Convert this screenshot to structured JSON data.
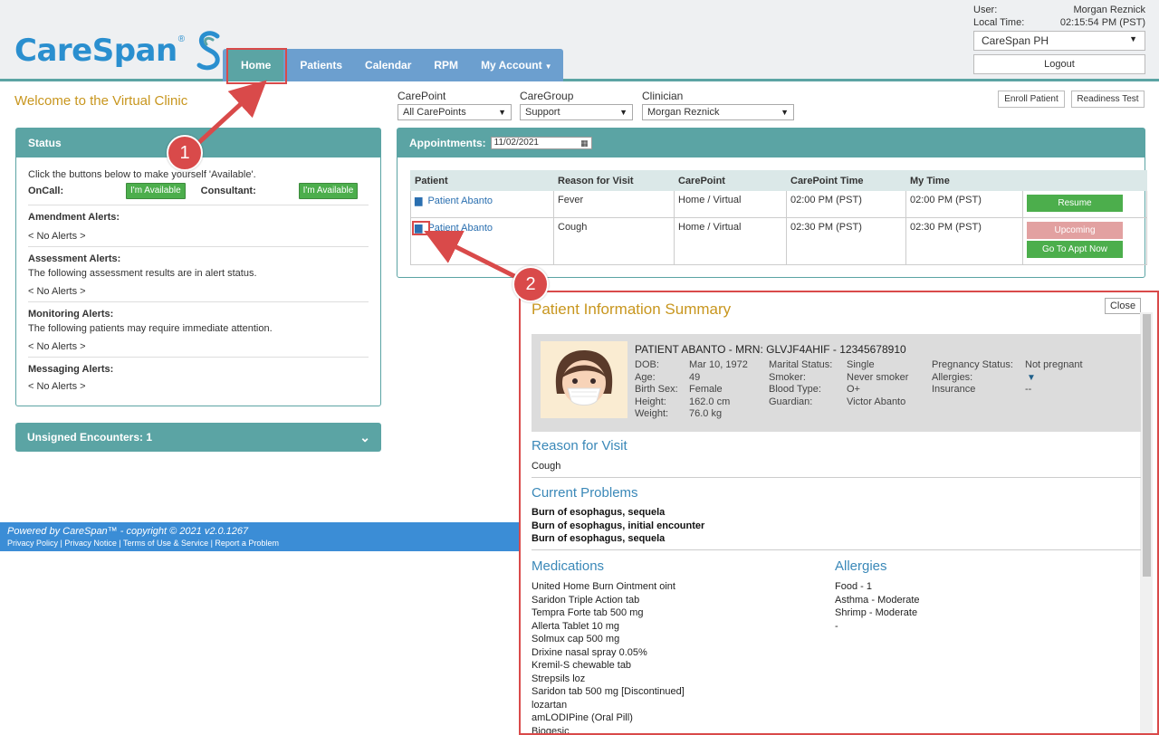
{
  "app": {
    "brand": "CareSpan",
    "brand_mark": "®"
  },
  "nav": {
    "home": "Home",
    "patients": "Patients",
    "calendar": "Calendar",
    "rpm": "RPM",
    "account": "My Account"
  },
  "user": {
    "user_label": "User:",
    "user_name": "Morgan Reznick",
    "time_label": "Local Time:",
    "time_value": "02:15:54 PM (PST)",
    "org": "CareSpan PH",
    "logout": "Logout"
  },
  "welcome": "Welcome to the Virtual Clinic",
  "filters": {
    "carepoint": {
      "label": "CarePoint",
      "value": "All CarePoints"
    },
    "caregroup": {
      "label": "CareGroup",
      "value": "Support"
    },
    "clinician": {
      "label": "Clinician",
      "value": "Morgan Reznick"
    }
  },
  "buttons": {
    "enroll": "Enroll Patient",
    "readiness": "Readiness Test"
  },
  "status": {
    "title": "Status",
    "intro": "Click the buttons below to make yourself 'Available'.",
    "oncall": "OnCall:",
    "consultant": "Consultant:",
    "available": "I'm Available",
    "amendment": "Amendment Alerts:",
    "no_alerts": "< No Alerts >",
    "assessment": "Assessment Alerts:",
    "assessment_desc": "The following assessment results are in alert status.",
    "monitoring": "Monitoring Alerts:",
    "monitoring_desc": "The following patients may require immediate attention.",
    "messaging": "Messaging Alerts:"
  },
  "unsigned": "Unsigned Encounters: 1",
  "footer": {
    "powered": "Powered by CareSpan™ - copyright © 2021 v2.0.1267",
    "links": "Privacy Policy  |  Privacy Notice  |  Terms of Use & Service  |  Report a Problem"
  },
  "appointments": {
    "title": "Appointments:",
    "date": "11/02/2021",
    "columns": [
      "Patient",
      "Reason for Visit",
      "CarePoint",
      "CarePoint Time",
      "My Time",
      ""
    ],
    "rows": [
      {
        "patient": "Patient Abanto",
        "reason": "Fever",
        "carepoint": "Home / Virtual",
        "cp_time": "02:00 PM (PST)",
        "my_time": "02:00 PM (PST)",
        "action": "Resume"
      },
      {
        "patient": "Patient Abanto",
        "reason": "Cough",
        "carepoint": "Home / Virtual",
        "cp_time": "02:30 PM (PST)",
        "my_time": "02:30 PM (PST)",
        "action": "Upcoming",
        "action2": "Go To Appt Now"
      }
    ]
  },
  "summary": {
    "title": "Patient Information Summary",
    "close": "Close",
    "patient_header": "PATIENT ABANTO - MRN: GLVJF4AHIF - 12345678910",
    "col1": {
      "labels": [
        "DOB:",
        "Age:",
        "Birth Sex:",
        "Height:",
        "Weight:"
      ],
      "values": [
        "Mar 10, 1972",
        "49",
        "Female",
        "162.0 cm",
        "76.0 kg"
      ]
    },
    "col2": {
      "labels": [
        "Marital Status:",
        "Smoker:",
        "Blood Type:",
        "Guardian:"
      ],
      "values": [
        "Single",
        "Never smoker",
        "O+",
        "Victor Abanto"
      ]
    },
    "col3": {
      "labels": [
        "Pregnancy Status:",
        "Allergies:",
        "Insurance"
      ],
      "values": [
        "Not pregnant",
        "",
        "--"
      ]
    },
    "reason_title": "Reason for Visit",
    "reason": "Cough",
    "problems_title": "Current Problems",
    "problems": [
      "Burn of esophagus, sequela",
      "Burn of esophagus, initial encounter",
      "Burn of esophagus, sequela"
    ],
    "medications_title": "Medications",
    "medications": [
      "United Home Burn Ointment oint",
      "Saridon Triple Action tab",
      "Tempra Forte tab 500 mg",
      "Allerta Tablet 10 mg",
      "Solmux cap 500 mg",
      "Drixine nasal spray 0.05%",
      "Kremil-S chewable tab",
      "Strepsils loz",
      "Saridon tab 500 mg [Discontinued]",
      "lozartan",
      "amLODIPine (Oral Pill)",
      "Biogesic"
    ],
    "allergies_title": "Allergies",
    "allergies": [
      "Food - 1",
      "Asthma - Moderate",
      "Shrimp - Moderate",
      "-"
    ]
  },
  "annotations": {
    "step1": "1",
    "step2": "2"
  },
  "colors": {
    "teal": "#5ba4a4",
    "nav_blue": "#6c9fcf",
    "accent_gold": "#c8961e",
    "annotation_red": "#d94a4a",
    "green": "#4cae4c"
  }
}
